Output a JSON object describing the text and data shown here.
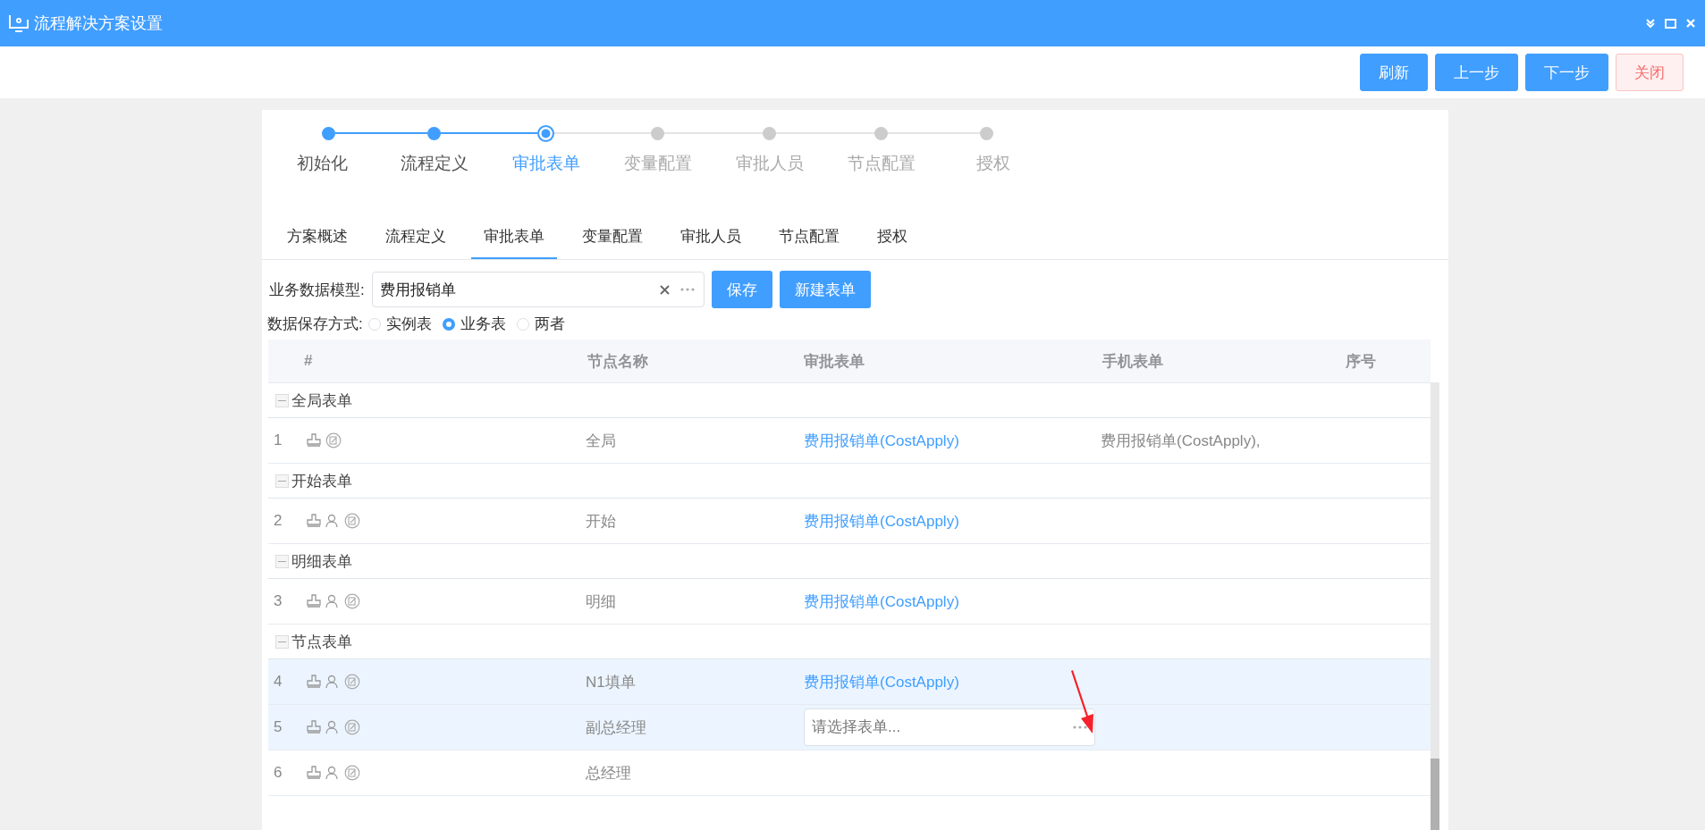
{
  "window": {
    "title": "流程解决方案设置"
  },
  "toolbar": {
    "buttons": [
      {
        "label": "刷新",
        "kind": "primary"
      },
      {
        "label": "上一步",
        "kind": "primary"
      },
      {
        "label": "下一步",
        "kind": "primary"
      },
      {
        "label": "关闭",
        "kind": "danger"
      }
    ]
  },
  "steps": [
    {
      "label": "初始化",
      "done": true,
      "selected": false
    },
    {
      "label": "流程定义",
      "done": true,
      "selected": false
    },
    {
      "label": "审批表单",
      "done": false,
      "selected": true
    },
    {
      "label": "变量配置",
      "done": false,
      "selected": false
    },
    {
      "label": "审批人员",
      "done": false,
      "selected": false
    },
    {
      "label": "节点配置",
      "done": false,
      "selected": false
    },
    {
      "label": "授权",
      "done": false,
      "selected": false
    }
  ],
  "tabs": [
    {
      "label": "方案概述",
      "selected": false
    },
    {
      "label": "流程定义",
      "selected": false
    },
    {
      "label": "审批表单",
      "selected": true
    },
    {
      "label": "变量配置",
      "selected": false
    },
    {
      "label": "审批人员",
      "selected": false
    },
    {
      "label": "节点配置",
      "selected": false
    },
    {
      "label": "授权",
      "selected": false
    }
  ],
  "model": {
    "label": "业务数据模型:",
    "value": "费用报销单",
    "buttons": [
      "保存",
      "新建表单"
    ]
  },
  "storage": {
    "label": "数据保存方式:",
    "options": [
      {
        "label": "实例表",
        "selected": false
      },
      {
        "label": "业务表",
        "selected": true
      },
      {
        "label": "两者",
        "selected": false
      }
    ]
  },
  "table": {
    "columns": [
      "#",
      "节点名称",
      "审批表单",
      "手机表单",
      "序号"
    ],
    "groups": [
      {
        "title": "全局表单",
        "expanded": true,
        "rows": [
          {
            "index": "1",
            "user_icon": false,
            "name": "全局",
            "form": {
              "kind": "link",
              "text": "费用报销单(CostApply)"
            },
            "mobile_form": "费用报销单(CostApply),",
            "selected": false
          }
        ]
      },
      {
        "title": "开始表单",
        "expanded": true,
        "rows": [
          {
            "index": "2",
            "user_icon": true,
            "name": "开始",
            "form": {
              "kind": "link",
              "text": "费用报销单(CostApply)"
            },
            "selected": false
          }
        ]
      },
      {
        "title": "明细表单",
        "expanded": true,
        "rows": [
          {
            "index": "3",
            "user_icon": true,
            "name": "明细",
            "form": {
              "kind": "link",
              "text": "费用报销单(CostApply)"
            },
            "selected": false
          }
        ]
      },
      {
        "title": "节点表单",
        "expanded": true,
        "rows": [
          {
            "index": "4",
            "user_icon": true,
            "name": "N1填单",
            "form": {
              "kind": "link",
              "text": "费用报销单(CostApply)"
            },
            "selected": true
          },
          {
            "index": "5",
            "user_icon": true,
            "name": "副总经理",
            "form": {
              "kind": "field",
              "placeholder": "请选择表单..."
            },
            "selected": true
          },
          {
            "index": "6",
            "user_icon": true,
            "name": "总经理",
            "form": {
              "kind": "none"
            },
            "selected": false
          }
        ]
      }
    ]
  }
}
